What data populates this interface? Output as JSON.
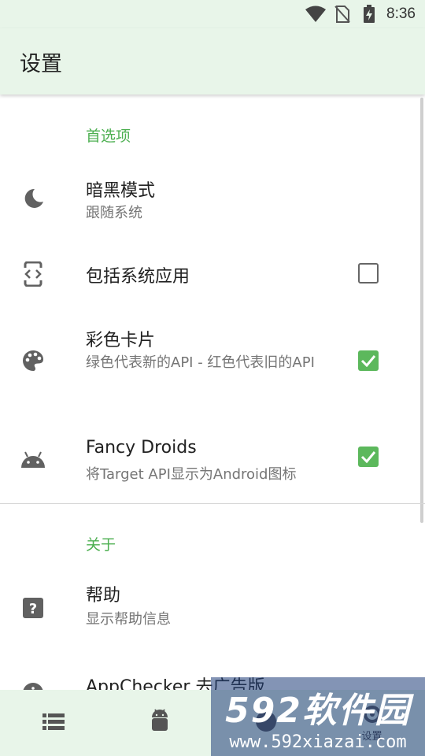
{
  "status_bar": {
    "time": "8:36",
    "icons": [
      "wifi-icon",
      "no-sim-icon",
      "battery-charging-icon"
    ]
  },
  "app_bar": {
    "title": "设置"
  },
  "sections": [
    {
      "title": "首选项"
    },
    {
      "title": "关于"
    }
  ],
  "preferences": {
    "dark_mode": {
      "title": "暗黑模式",
      "summary": "跟随系统",
      "icon": "moon-icon"
    },
    "include_system": {
      "title": "包括系统应用",
      "checked": false,
      "icon": "app-code-icon"
    },
    "colored_cards": {
      "title": "彩色卡片",
      "summary": "绿色代表新的API - 红色代表旧的API",
      "checked": true,
      "icon": "palette-icon"
    },
    "fancy_droids": {
      "title": "Fancy Droids",
      "summary": "将Target API显示为Android图标",
      "checked": true,
      "icon": "android-icon"
    }
  },
  "about": {
    "help": {
      "title": "帮助",
      "summary": "显示帮助信息",
      "icon": "help-icon"
    },
    "pro": {
      "title": "AppChecker 去广告版",
      "icon": "info-icon"
    }
  },
  "bottom_nav": {
    "items": [
      {
        "icon": "list-icon"
      },
      {
        "icon": "android-icon"
      },
      {
        "icon": "circle-icon"
      },
      {
        "icon": "gear-icon",
        "label": "设置"
      }
    ]
  },
  "watermark": {
    "line1": "592软件园",
    "line2": "www.592xiazai.com"
  },
  "colors": {
    "accent": "#4caf50",
    "bar_bg": "#e8f5e9",
    "check_green": "#5cb85c"
  }
}
